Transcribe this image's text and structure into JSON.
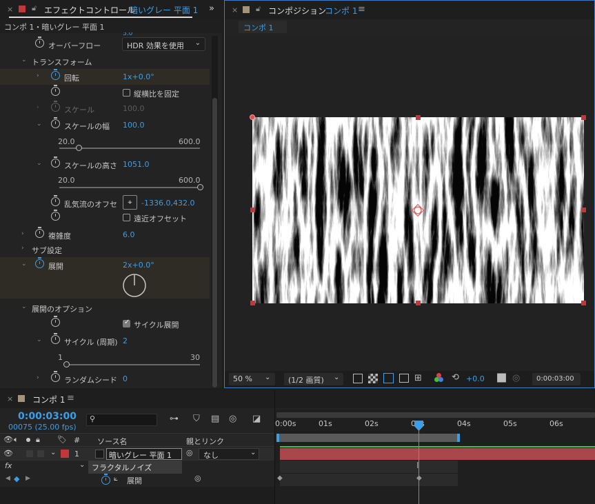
{
  "effect_controls": {
    "tab_title": "エフェクトコントロール",
    "tab_layer": "暗いグレー 平面 1",
    "header": "コンポ 1・暗いグレー 平面 1",
    "partial_value": "5.0",
    "overflow_label": "オーバーフロー",
    "overflow_value": "HDR 効果を使用",
    "transform_label": "トランスフォーム",
    "rotation_label": "回転",
    "rotation_value": "1x+0.0°",
    "lock_aspect_label": "縦横比を固定",
    "scale_label": "スケール",
    "scale_value": "100.0",
    "scale_width_label": "スケールの幅",
    "scale_width_value": "100.0",
    "scale_width_min": "20.0",
    "scale_width_max": "600.0",
    "scale_width_fraction": 0.138,
    "scale_height_label": "スケールの高さ",
    "scale_height_value": "1051.0",
    "scale_height_min": "20.0",
    "scale_height_max": "600.0",
    "scale_height_fraction": 1.0,
    "offset_label": "乱気流のオフセ",
    "offset_value": "-1336.0,432.0",
    "perspective_label": "遠近オフセット",
    "complexity_label": "複雑度",
    "complexity_value": "6.0",
    "sub_settings_label": "サブ設定",
    "evolution_label": "展開",
    "evolution_value": "2x+0.0°",
    "evolution_options_label": "展開のオプション",
    "cycle_evolution_label": "サイクル展開",
    "cycle_label": "サイクル (周期)",
    "cycle_value": "2",
    "cycle_min": "1",
    "cycle_max": "30",
    "cycle_fraction": 0.0,
    "random_seed_label": "ランダムシード",
    "random_seed_value": "0"
  },
  "composition": {
    "tab_title": "コンポジション",
    "tab_comp": "コンポ 1",
    "sub_tab": "コンポ 1",
    "zoom": "50 %",
    "quality": "(1/2 画質)",
    "exposure": "+0.0",
    "timecode": "0:00:03:00"
  },
  "timeline": {
    "tab_title": "コンポ 1",
    "timecode": "0:00:03:00",
    "frames": "00075 (25.00 fps)",
    "search_placeholder": "",
    "col_number": "#",
    "col_source": "ソース名",
    "col_parent": "親とリンク",
    "layer_number": "1",
    "layer_name": "暗いグレー 平面 1",
    "parent_value": "なし",
    "fx_label": "fx",
    "effect_name": "フラクタルノイズ",
    "property_name": "展開",
    "ruler": [
      "0:00s",
      "01s",
      "02s",
      "03s",
      "04s",
      "05s",
      "06s"
    ],
    "playhead_seconds": 3,
    "work_area_end_seconds": 4
  },
  "colors": {
    "accent": "#3d9ee8",
    "layer_label": "#c0383a",
    "layer_bar": "#a9484b",
    "green_line": "#3fc43f"
  }
}
